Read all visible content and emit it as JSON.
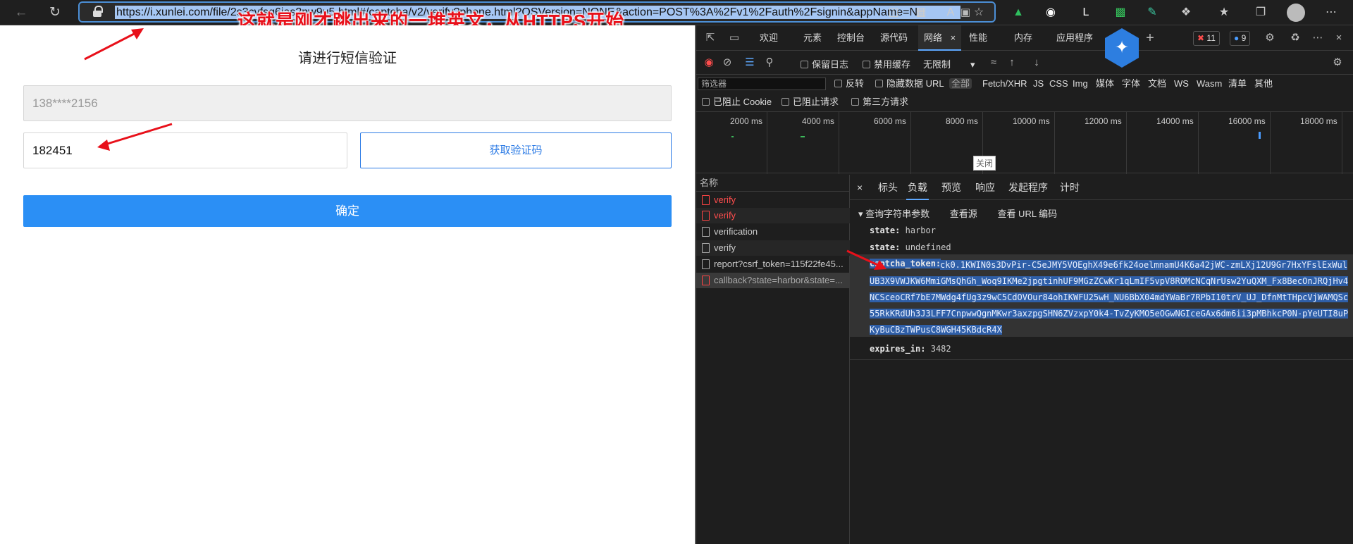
{
  "browser": {
    "url": "https://i.xunlei.com/file/2s3cvfsq6ias2nw9u5.html#/captcha/v2/verify?phone.html?OSVersion=NONE&action=POST%3A%2Fv1%2Fauth%2Fsignin&appName=N"
  },
  "annotation": {
    "banner": "这就是刚才跳出来的一堆英文，从HTTPS开始"
  },
  "page": {
    "title": "请进行短信验证",
    "phone_value": "138****2156",
    "code_value": "182451",
    "get_code_label": "获取验证码",
    "confirm_label": "确定"
  },
  "devtools": {
    "tabs": [
      "欢迎",
      "元素",
      "控制台",
      "源代码",
      "网络",
      "性能",
      "内存",
      "应用程序"
    ],
    "active_tab": "网络",
    "error_count": "11",
    "message_count": "9",
    "toolbar": {
      "preserve_log": "保留日志",
      "disable_cache": "禁用缓存",
      "throttling": "无限制"
    },
    "filter": {
      "placeholder": "筛选器",
      "invert": "反转",
      "hide_data_url": "隐藏数据 URL",
      "types": [
        "全部",
        "Fetch/XHR",
        "JS",
        "CSS",
        "Img",
        "媒体",
        "字体",
        "文档",
        "WS",
        "Wasm",
        "清单",
        "其他"
      ],
      "blocked_cookie": "已阻止 Cookie",
      "blocked_requests": "已阻止请求",
      "third_party": "第三方请求"
    },
    "timeline": {
      "ticks": [
        "2000 ms",
        "4000 ms",
        "6000 ms",
        "8000 ms",
        "10000 ms",
        "12000 ms",
        "14000 ms",
        "16000 ms",
        "18000 ms"
      ],
      "close_label": "关闭"
    },
    "requests_header": "名称",
    "requests": [
      {
        "name": "verify",
        "status": "error"
      },
      {
        "name": "verify",
        "status": "error"
      },
      {
        "name": "verification",
        "status": "ok"
      },
      {
        "name": "verify",
        "status": "ok"
      },
      {
        "name": "report?csrf_token=115f22fe45...",
        "status": "ok"
      },
      {
        "name": "callback?state=harbor&state=...",
        "status": "selected"
      }
    ],
    "detail_tabs": [
      "标头",
      "负载",
      "预览",
      "响应",
      "发起程序",
      "计时"
    ],
    "active_detail_tab": "负载",
    "query_section": "查询字符串参数",
    "view_source": "查看源",
    "view_url_encoded": "查看 URL 编码",
    "params": [
      {
        "key": "state:",
        "value": "harbor"
      },
      {
        "key": "state:",
        "value": "undefined"
      },
      {
        "key": "captcha_token:",
        "value": "ck0.1KWIN0s3DvPir-C5eJMY5VOEghX49e6fk24oelmnamU4K6a42jWC-zmLXj12U9Gr7HxYFslExWulUB3X9VWJKW6MmiGMsQhGh_Woq9IKMe2jpgtinhUF9MGzZCwKr1qLmIF5vpV8ROMcNCqNrUsw2YuQXM_Fx8BecOnJRQjHv4NCSceoCRf7bE7MWdg4fUg3z9wC5CdOVOur84ohIKWFU25wH_NU6BbX04mdYWaBr7RPbI10trV_UJ_DfnMtTHpcVjWAMQSc55RkKRdUh3J3LFF7CnpwwQgnMKwr3axzpgSHN6ZVzxpY0k4-TvZyKMO5eOGwNGIceGAx6dm6ii3pMBhkcP0N-pYeUTI8uPKyBuCBzTWPusC8WGH45KBdcR4X"
      },
      {
        "key": "expires_in:",
        "value": "3482"
      }
    ],
    "colors": {
      "accent": "#5ea8ff",
      "error": "#ff4d4d"
    }
  }
}
